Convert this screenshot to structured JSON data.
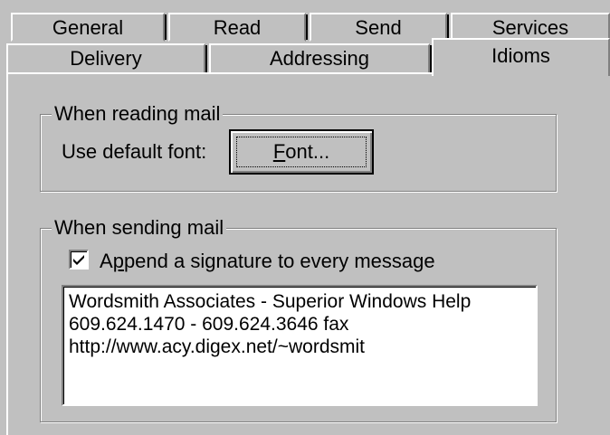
{
  "tabs": {
    "row1": [
      "General",
      "Read",
      "Send",
      "Services"
    ],
    "row2": [
      "Delivery",
      "Addressing",
      "Idioms"
    ],
    "active": "Idioms"
  },
  "reading": {
    "group_label": "When reading mail",
    "font_label": "Use default font:",
    "font_button": {
      "mnemonic": "F",
      "rest": "ont..."
    }
  },
  "sending": {
    "group_label": "When sending mail",
    "append_checkbox": {
      "checked": true,
      "pre": "A",
      "mnemonic": "p",
      "rest": "pend a signature to every message"
    },
    "signature_text": "Wordsmith Associates - Superior Windows Help\n609.624.1470 - 609.624.3646 fax\nhttp://www.acy.digex.net/~wordsmit"
  }
}
